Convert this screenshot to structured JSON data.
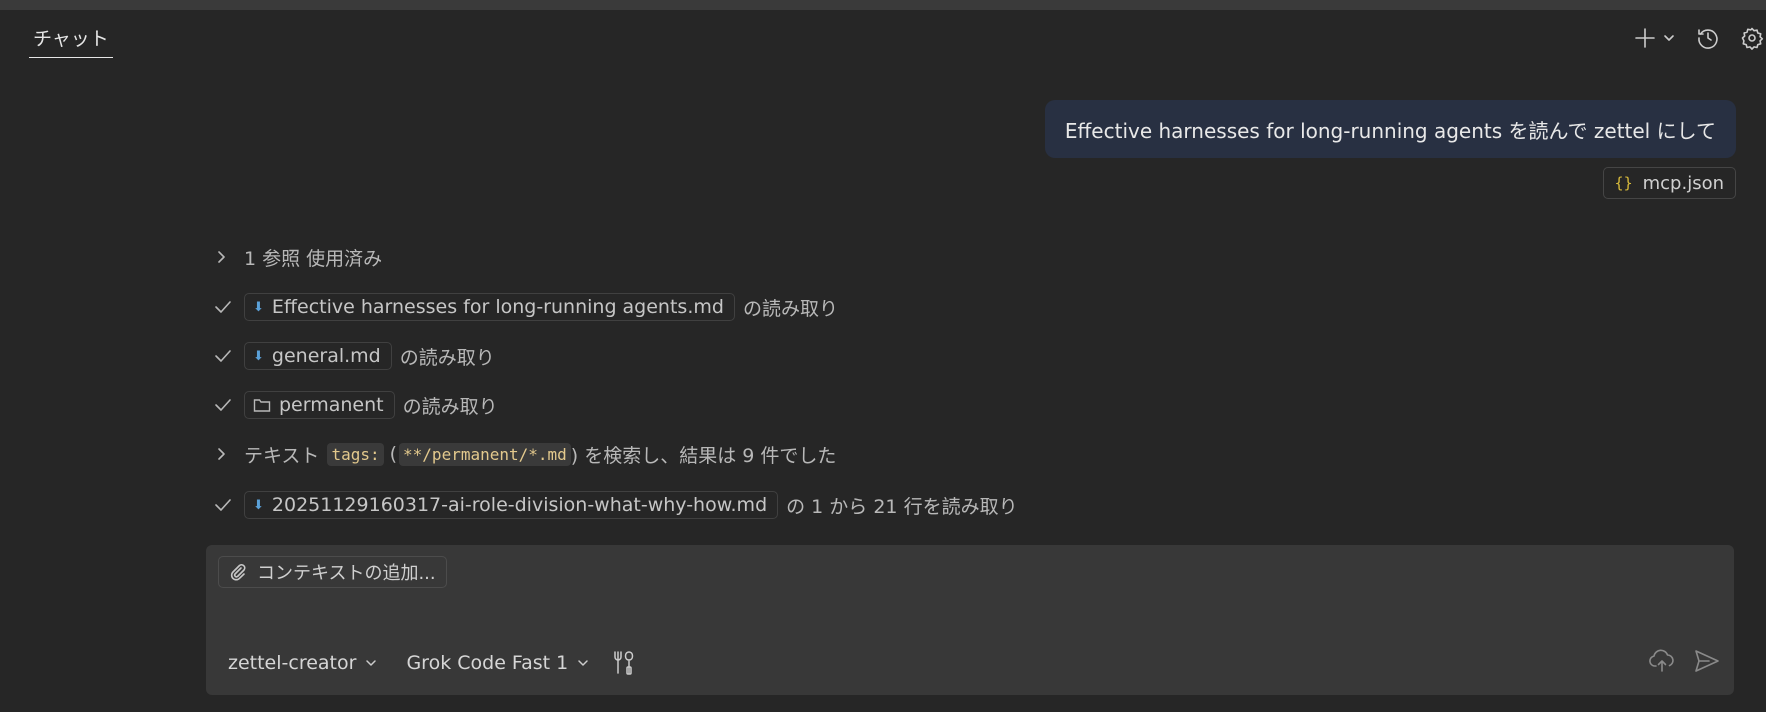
{
  "tabs": {
    "chat_label": "チャット"
  },
  "header_icons": [
    "add-icon",
    "chevron-down-icon",
    "history-icon",
    "gear-icon"
  ],
  "user_message": {
    "text": "Effective harnesses for long-running agents を読んで zettel にして",
    "attachment": "mcp.json"
  },
  "steps": {
    "references": "1 参照 使用済み",
    "read1": {
      "file": "Effective harnesses for long-running agents.md",
      "suffix": "の読み取り"
    },
    "read2": {
      "file": "general.md",
      "suffix": "の読み取り"
    },
    "read3": {
      "folder": "permanent",
      "suffix": "の読み取り"
    },
    "search": {
      "prefix": "テキスト",
      "query": "tags:",
      "paren_open": "(",
      "glob": "**/permanent/*.md",
      "suffix": ") を検索し、結果は 9 件でした"
    },
    "read4": {
      "file": "20251129160317-ai-role-division-what-why-how.md",
      "suffix": "の 1 から 21 行を読み取り"
    }
  },
  "input": {
    "add_context_label": "コンテキストの追加...",
    "agent": "zettel-creator",
    "model": "Grok Code Fast 1"
  },
  "colors": {
    "background": "#262626",
    "user_bubble": "#283042",
    "input_bg": "#383838",
    "file_icon": "#5aa0d8",
    "json_icon": "#d7ba3b"
  }
}
